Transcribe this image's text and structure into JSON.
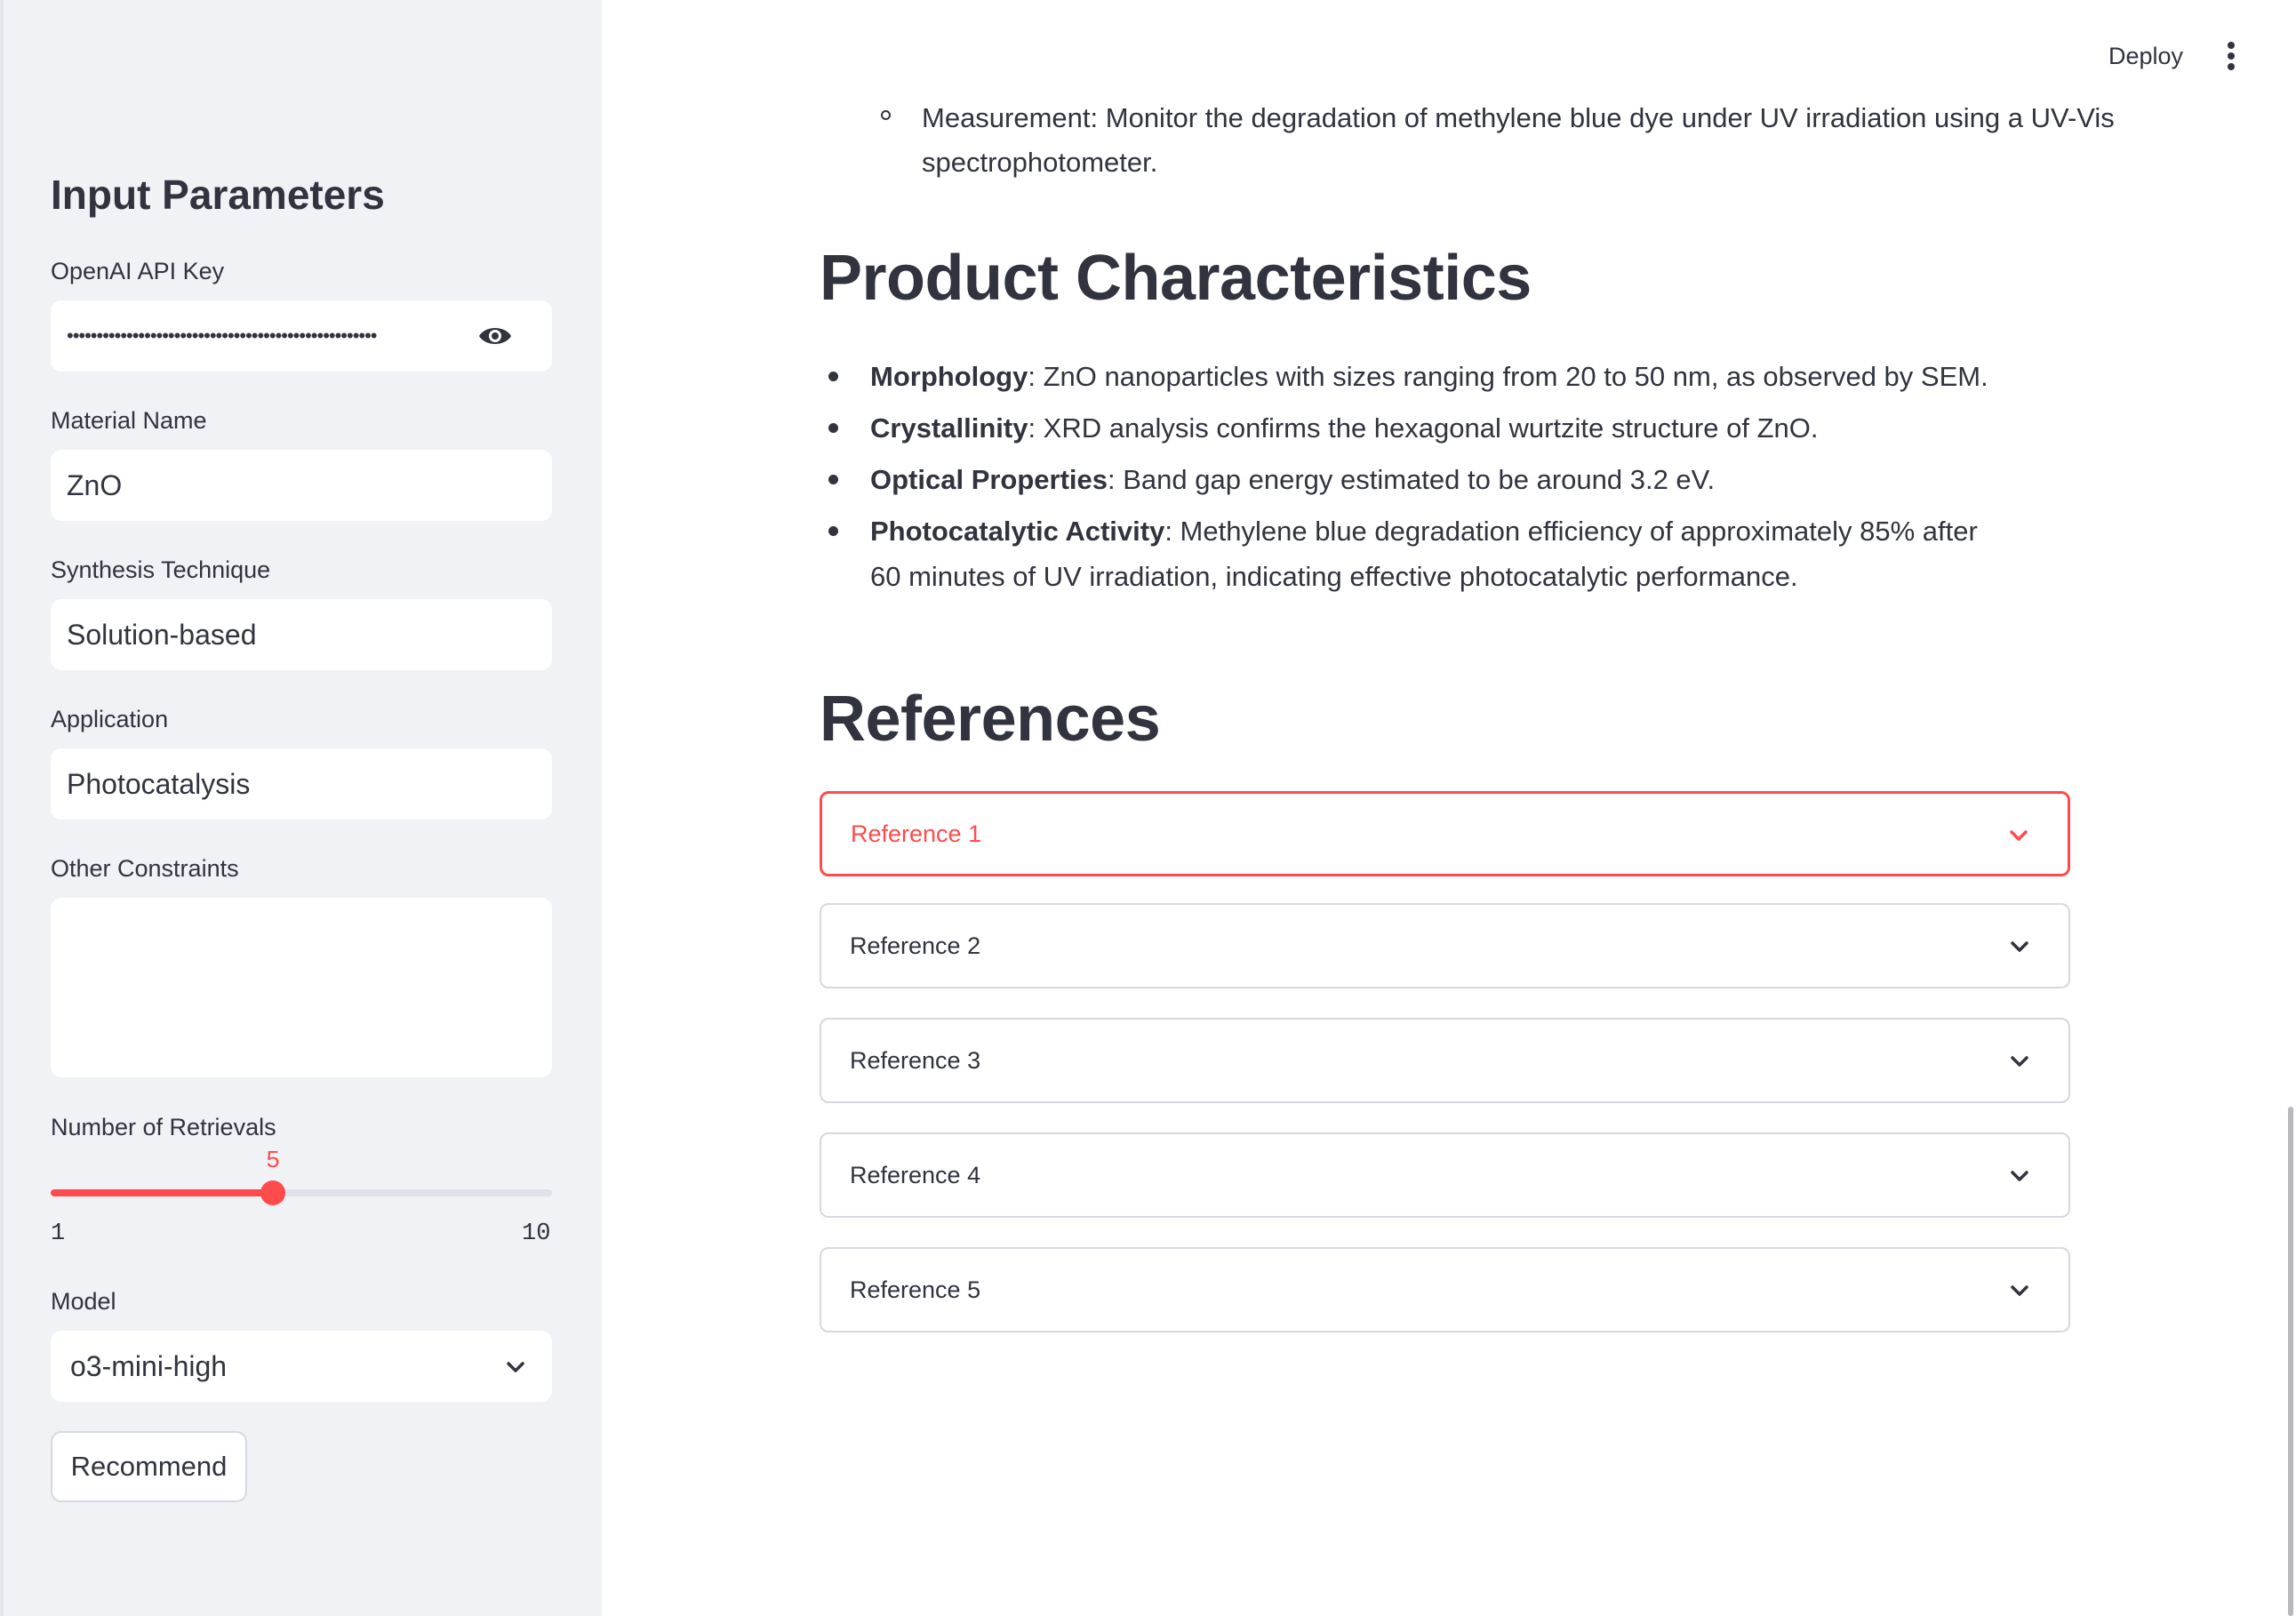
{
  "header": {
    "deploy_label": "Deploy",
    "menu_icon": "vertical-dots-icon"
  },
  "sidebar": {
    "title": "Input Parameters",
    "api_key": {
      "label": "OpenAI API Key",
      "value": "••••••••••••••••••••••••••••••••••••••••••••••••••••",
      "toggle_icon": "eye-icon"
    },
    "material": {
      "label": "Material Name",
      "value": "ZnO"
    },
    "technique": {
      "label": "Synthesis Technique",
      "value": "Solution-based"
    },
    "application": {
      "label": "Application",
      "value": "Photocatalysis"
    },
    "constraints": {
      "label": "Other Constraints",
      "value": ""
    },
    "retrievals": {
      "label": "Number of Retrievals",
      "value": "5",
      "min": "1",
      "max": "10",
      "fraction": 0.444
    },
    "model": {
      "label": "Model",
      "value": "o3-mini-high"
    },
    "recommend_label": "Recommend"
  },
  "main": {
    "measurement_line1": "Measurement: Monitor the degradation of methylene blue dye under UV irradiation using a UV-Vis",
    "measurement_line2": "spectrophotometer.",
    "product_heading": "Product Characteristics",
    "characteristics": [
      {
        "term": "Morphology",
        "text": ": ZnO nanoparticles with sizes ranging from 20 to 50 nm, as observed by SEM."
      },
      {
        "term": "Crystallinity",
        "text": ": XRD analysis confirms the hexagonal wurtzite structure of ZnO."
      },
      {
        "term": "Optical Properties",
        "text": ": Band gap energy estimated to be around 3.2 eV."
      },
      {
        "term": "Photocatalytic Activity",
        "text": ": Methylene blue degradation efficiency of approximately 85% after 60 minutes of UV irradiation, indicating effective photocatalytic performance."
      }
    ],
    "references_heading": "References",
    "references": [
      {
        "label": "Reference 1"
      },
      {
        "label": "Reference 2"
      },
      {
        "label": "Reference 3"
      },
      {
        "label": "Reference 4"
      },
      {
        "label": "Reference 5"
      }
    ]
  },
  "colors": {
    "accent": "#ff4b4b",
    "sidebar_bg": "#f0f2f6",
    "text": "#31333f",
    "grammarly": "#15c39a"
  }
}
